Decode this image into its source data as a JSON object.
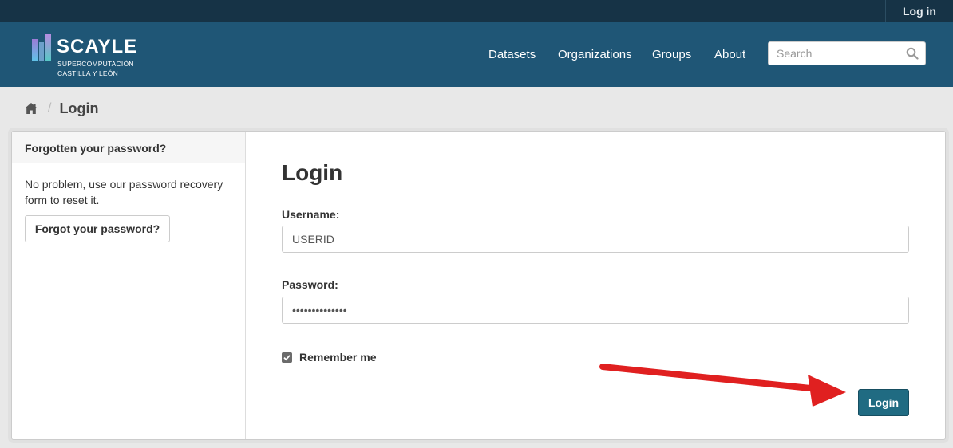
{
  "topbar": {
    "login_link": "Log in"
  },
  "logo": {
    "brand": "SCAYLE",
    "subtitle_line1": "SUPERCOMPUTACIÓN",
    "subtitle_line2": "CASTILLA Y LEÓN"
  },
  "nav": {
    "items": [
      {
        "label": "Datasets"
      },
      {
        "label": "Organizations"
      },
      {
        "label": "Groups"
      },
      {
        "label": "About"
      }
    ]
  },
  "search": {
    "placeholder": "Search",
    "icon": "search-icon"
  },
  "breadcrumb": {
    "home_icon": "home-icon",
    "separator": "/",
    "current": "Login"
  },
  "aside": {
    "heading": "Forgotten your password?",
    "text": "No problem, use our password recovery form to reset it.",
    "button": "Forgot your password?"
  },
  "form": {
    "title": "Login",
    "username_label": "Username:",
    "username_value": "USERID",
    "password_label": "Password:",
    "password_value": "••••••••••••••",
    "remember_label": "Remember me",
    "remember_checked": true,
    "submit": "Login"
  },
  "annotation": {
    "arrow_color": "#e02020"
  },
  "colors": {
    "topbar": "#163346",
    "masthead": "#1f5676",
    "primary_button": "#206b82"
  }
}
